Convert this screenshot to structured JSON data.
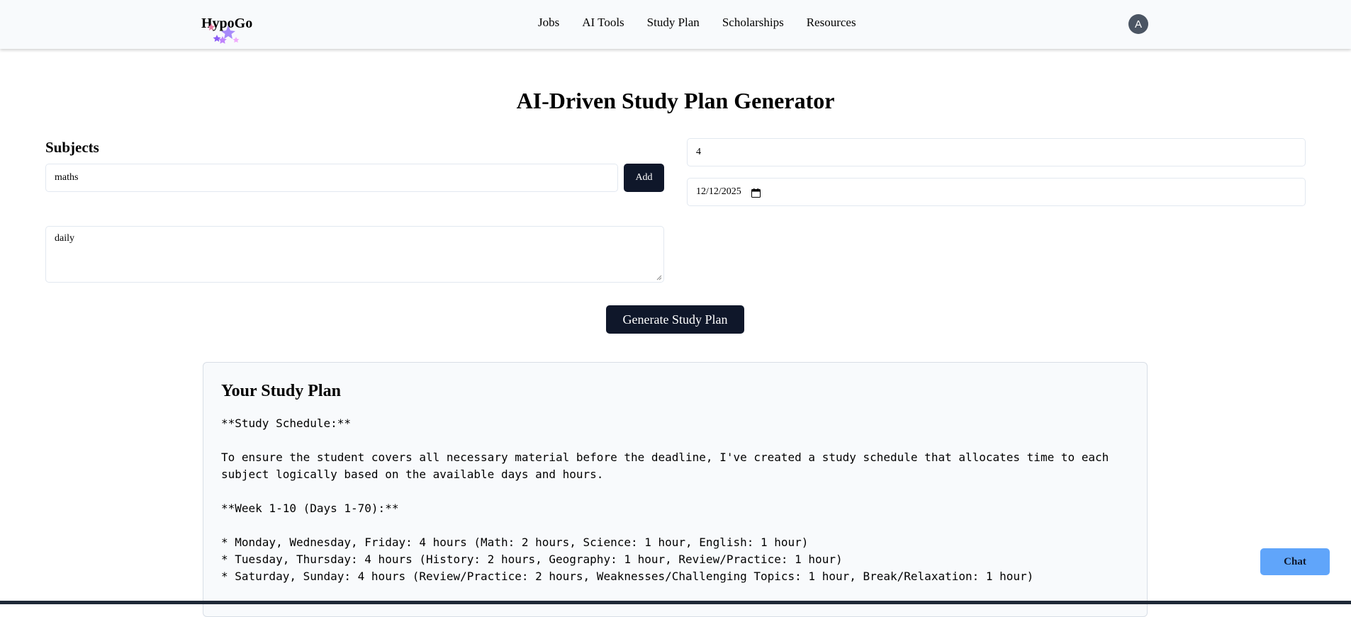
{
  "app": {
    "logo_text": "HypoGo",
    "avatar_initial": "A"
  },
  "nav": {
    "items": [
      "Jobs",
      "AI Tools",
      "Study Plan",
      "Scholarships",
      "Resources"
    ]
  },
  "page": {
    "title": "AI-Driven Study Plan Generator"
  },
  "form": {
    "subjects_label": "Subjects",
    "subject_input_value": "maths",
    "add_label": "Add",
    "notes_value": "daily",
    "hours_value": "4",
    "date_value": "12/12/2025",
    "generate_label": "Generate Study Plan"
  },
  "result": {
    "heading": "Your Study Plan",
    "lines": [
      "**Study Schedule:**",
      "",
      "To ensure the student covers all necessary material before the deadline, I've created a study schedule that allocates time to each",
      "subject logically based on the available days and hours.",
      "",
      "**Week 1-10 (Days 1-70):**",
      "",
      "* Monday, Wednesday, Friday: 4 hours (Math: 2 hours, Science: 1 hour, English: 1 hour)",
      "* Tuesday, Thursday: 4 hours (History: 2 hours, Geography: 1 hour, Review/Practice: 1 hour)",
      "* Saturday, Sunday: 4 hours (Review/Practice: 2 hours, Weaknesses/Challenging Topics: 1 hour, Break/Relaxation: 1 hour)"
    ]
  },
  "chat": {
    "label": "Chat"
  },
  "colors": {
    "primary_button": "#0f172a",
    "chat_button": "#60a5fa",
    "avatar": "#4b5563",
    "nav_background": "#f8fafc",
    "card_background": "#f8fafc"
  },
  "icons": {
    "logo_decoration": "stars-icon",
    "date_picker": "calendar-icon",
    "textarea_resize": "resize-handle-icon"
  }
}
